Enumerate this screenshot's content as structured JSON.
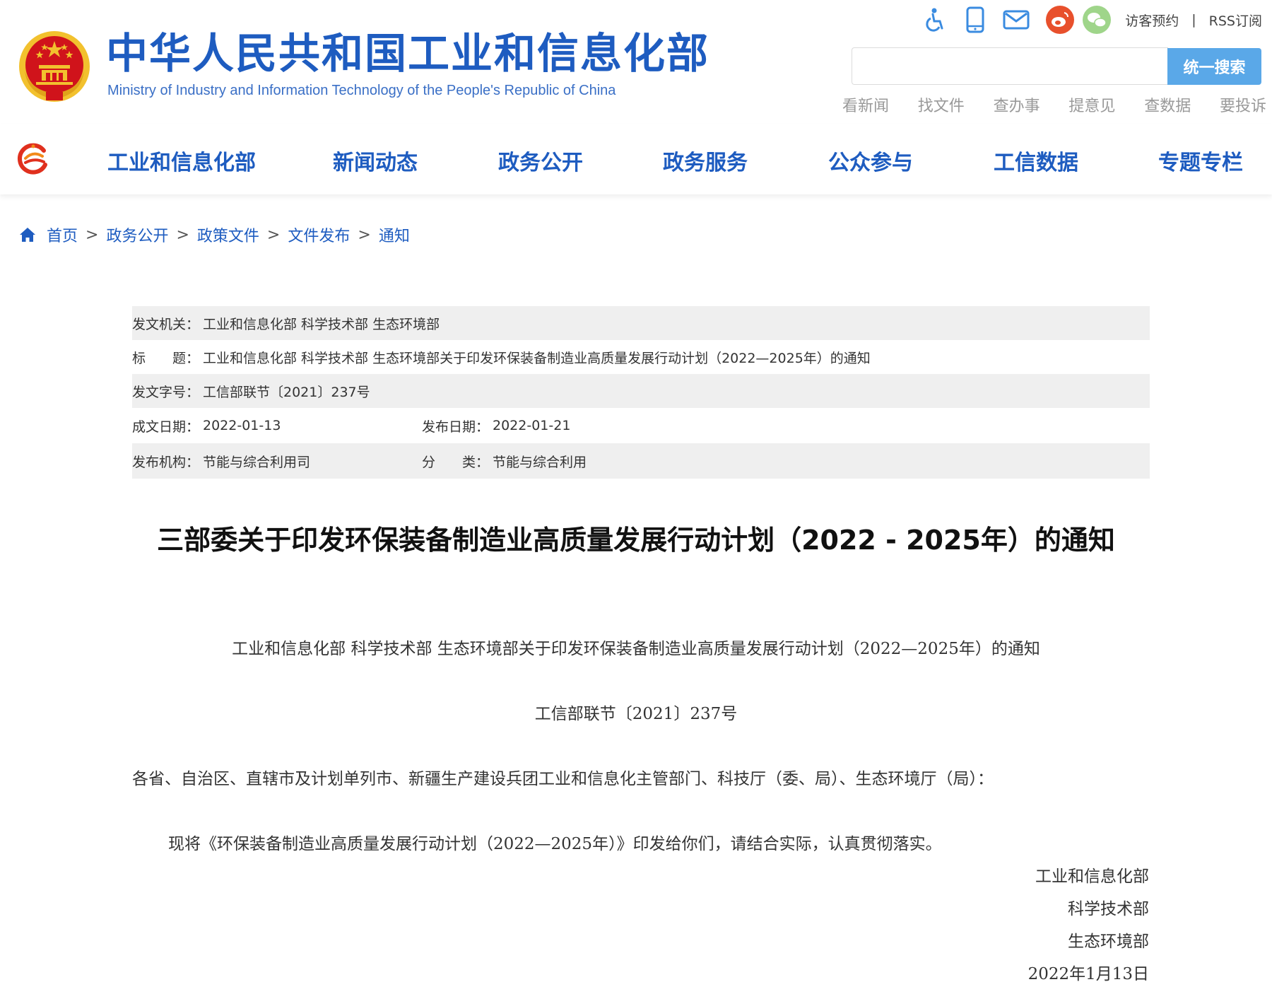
{
  "header": {
    "title": "中华人民共和国工业和信息化部",
    "subtitle": "Ministry of Industry and Information Technology of the People's Republic of China",
    "tools": {
      "accessibility": "accessibility-icon",
      "mobile": "mobile-icon",
      "mail": "mail-icon",
      "weibo": "weibo-icon",
      "wechat": "wechat-icon",
      "visitor": "访客预约",
      "separator": "|",
      "rss": "RSS订阅"
    },
    "search": {
      "placeholder": "",
      "button": "统一搜索"
    },
    "quick_links": [
      "看新闻",
      "找文件",
      "查办事",
      "提意见",
      "查数据",
      "要投诉"
    ]
  },
  "nav": {
    "items": [
      "工业和信息化部",
      "新闻动态",
      "政务公开",
      "政务服务",
      "公众参与",
      "工信数据",
      "专题专栏"
    ]
  },
  "breadcrumb": {
    "items": [
      "首页",
      "政务公开",
      "政策文件",
      "文件发布",
      "通知"
    ],
    "separator": ">"
  },
  "meta": {
    "issuer_label": "发文机关：",
    "issuer": "工业和信息化部 科学技术部 生态环境部",
    "title_label": "标　　题：",
    "title": "工业和信息化部 科学技术部 生态环境部关于印发环保装备制造业高质量发展行动计划（2022—2025年）的通知",
    "doc_no_label": "发文字号：",
    "doc_no": "工信部联节〔2021〕237号",
    "written_date_label": "成文日期：",
    "written_date": "2022-01-13",
    "publish_date_label": "发布日期：",
    "publish_date": "2022-01-21",
    "org_label": "发布机构：",
    "org": "节能与综合利用司",
    "category_label": "分　　类：",
    "category": "节能与综合利用"
  },
  "article": {
    "title": "三部委关于印发环保装备制造业高质量发展行动计划（2022 - 2025年）的通知",
    "doc_heading": "工业和信息化部 科学技术部 生态环境部关于印发环保装备制造业高质量发展行动计划（2022—2025年）的通知",
    "doc_number": "工信部联节〔2021〕237号",
    "salutation": "各省、自治区、直辖市及计划单列市、新疆生产建设兵团工业和信息化主管部门、科技厅（委、局）、生态环境厅（局）：",
    "paragraph": "现将《环保装备制造业高质量发展行动计划（2022—2025年）》印发给你们，请结合实际，认真贯彻落实。",
    "signatures": [
      "工业和信息化部",
      "科学技术部",
      "生态环境部",
      "2022年1月13日"
    ]
  },
  "colors": {
    "brand_blue": "#1e5cc0",
    "search_button": "#5aa8e8",
    "meta_shade": "#efefef",
    "emblem_red": "#d0131b",
    "emblem_gold": "#f2c12e"
  }
}
